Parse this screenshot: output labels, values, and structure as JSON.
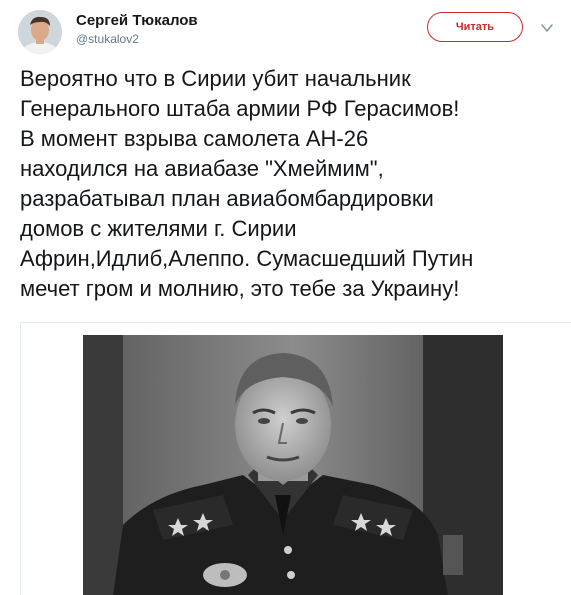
{
  "tweet": {
    "author": {
      "display_name": "Сергей Тюкалов",
      "username": "@stukalov2",
      "avatar_icon": "user-avatar-photo"
    },
    "follow_label": "Читать",
    "follow_color": "#cc2a2a",
    "more_icon": "chevron-down-icon",
    "text_lines": [
      "Вероятно что в Сирии убит начальник",
      "Генерального штаба армии РФ Герасимов!",
      "В момент взрыва самолета АН-26",
      "находился на авиабазе \"Хмеймим\",",
      "разрабатывал план авиабомбардировки",
      "домов с жителями г. Сирии",
      "Африн,Идлиб,Алеппо. Сумасшедший Путин",
      "мечет гром и молнию, это тебе за Украину!"
    ],
    "media": {
      "kind": "photo",
      "description_icon": "photo-military-officer",
      "tone": "black-and-white"
    }
  }
}
